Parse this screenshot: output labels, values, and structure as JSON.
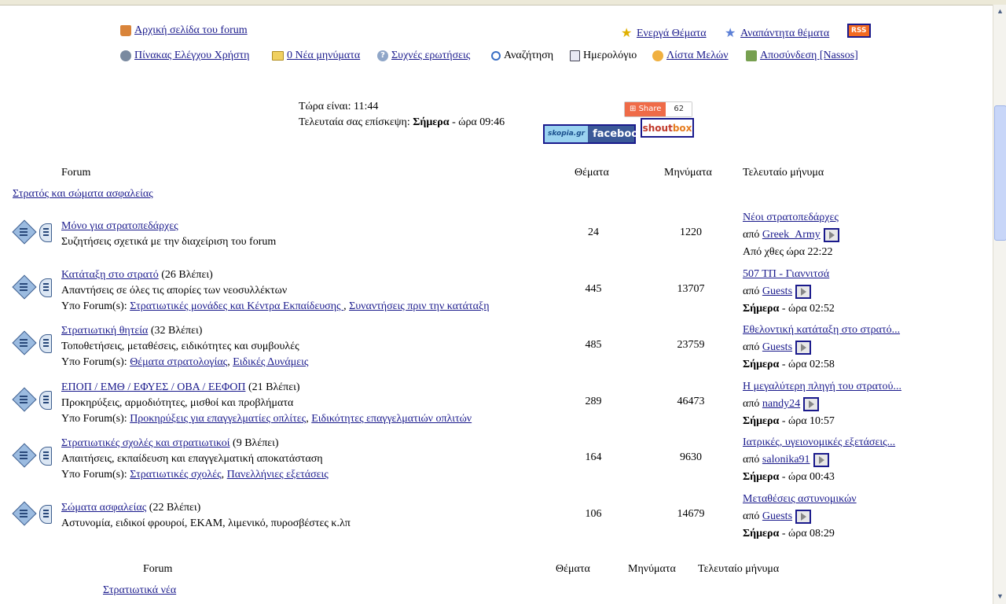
{
  "nav_row1": {
    "home": "Αρχική σελίδα του forum",
    "active_topics": "Ενεργά Θέματα",
    "unanswered": "Αναπάντητα θέματα",
    "rss": "RSS"
  },
  "nav_row2": {
    "control_panel": "Πίνακας Ελέγχου Χρήστη",
    "messages": "0 Νέα μηνύματα",
    "faq": "Συχνές ερωτήσεις",
    "search": "Αναζήτηση",
    "calendar": "Ημερολόγιο",
    "members": "Λίστα Μελών",
    "logout": "Αποσύνδεση [Nassos]"
  },
  "info": {
    "time_line": "Τώρα είναι: 11:44",
    "last_visit_prefix": "Τελευταία σας επίσκεψη: ",
    "last_visit_day": "Σήμερα",
    "last_visit_time": " - ώρα 09:46"
  },
  "share": {
    "label": "Share",
    "count": "62"
  },
  "badges": {
    "skopia": "skopia.gr",
    "facebook": "facebook",
    "shout1": "shout",
    "shout2": "box"
  },
  "table_header": {
    "forum": "Forum",
    "topics": "Θέματα",
    "posts": "Μηνύματα",
    "last_post": "Τελευταίο μήνυμα"
  },
  "category1": "Στρατός και σώματα ασφαλείας",
  "forums": [
    {
      "title": "Μόνο για στρατοπεδάρχες",
      "viewers": "",
      "desc": "Συζητήσεις σχετικά με την διαχείριση του forum",
      "sub_label": "",
      "subs": [],
      "topics": "24",
      "posts": "1220",
      "last_title": "Νέοι στρατοπεδάρχες",
      "by": "από ",
      "last_user": "Greek_Army",
      "last_day": "",
      "last_time": "Από χθες ώρα 22:22"
    },
    {
      "title": "Κατάταξη στο στρατό",
      "viewers": " (26 Βλέπει)",
      "desc": "Απαντήσεις σε όλες τις απορίες των νεοσυλλέκτων",
      "sub_label": "Υπο Forum(s): ",
      "subs": [
        "Στρατιωτικές μονάδες και Κέντρα Εκπαίδευσης ",
        "Συναντήσεις πριν την κατάταξη"
      ],
      "topics": "445",
      "posts": "13707",
      "last_title": "507 ΤΠ - Γιαννιτσά",
      "by": "από ",
      "last_user": "Guests",
      "last_day": "Σήμερα",
      "last_time": " - ώρα 02:52"
    },
    {
      "title": "Στρατιωτική θητεία",
      "viewers": " (32 Βλέπει)",
      "desc": "Τοποθετήσεις, μεταθέσεις, ειδικότητες και συμβουλές",
      "sub_label": "Υπο Forum(s): ",
      "subs": [
        "Θέματα στρατολογίας",
        "Ειδικές Δυνάμεις"
      ],
      "topics": "485",
      "posts": "23759",
      "last_title": "Εθελοντική κατάταξη στο στρατό...",
      "by": "από ",
      "last_user": "Guests",
      "last_day": "Σήμερα",
      "last_time": " - ώρα 02:58"
    },
    {
      "title": "ΕΠΟΠ / ΕΜΘ / ΕΦΥΕΣ / ΟΒΑ / ΕΕΦΟΠ",
      "viewers": " (21 Βλέπει)",
      "desc": "Προκηρύξεις, αρμοδιότητες, μισθοί και προβλήματα",
      "sub_label": "Υπο Forum(s): ",
      "subs": [
        "Προκηρύξεις για επαγγελματίες οπλίτες",
        "Ειδικότητες επαγγελματιών οπλιτών"
      ],
      "topics": "289",
      "posts": "46473",
      "last_title": "Η μεγαλύτερη πληγή του στρατού...",
      "by": "από ",
      "last_user": "nandy24",
      "last_day": "Σήμερα",
      "last_time": " - ώρα 10:57"
    },
    {
      "title": "Στρατιωτικές σχολές και στρατιωτικοί",
      "viewers": " (9 Βλέπει)",
      "desc": "Απαιτήσεις, εκπαίδευση και επαγγελματική αποκατάσταση",
      "sub_label": "Υπο Forum(s): ",
      "subs": [
        "Στρατιωτικές σχολές",
        "Πανελλήνιες εξετάσεις"
      ],
      "topics": "164",
      "posts": "9630",
      "last_title": "Ιατρικές, υγειονομικές εξετάσεις...",
      "by": "από ",
      "last_user": "salonika91",
      "last_day": "Σήμερα",
      "last_time": " - ώρα 00:43"
    },
    {
      "title": "Σώματα ασφαλείας",
      "viewers": " (22 Βλέπει)",
      "desc": "Αστυνομία, ειδικοί φρουροί, ΕΚΑΜ, λιμενικό, πυροσβέστες κ.λπ",
      "sub_label": "",
      "subs": [],
      "topics": "106",
      "posts": "14679",
      "last_title": "Μεταθέσεις αστυνομικών",
      "by": "από ",
      "last_user": "Guests",
      "last_day": "Σήμερα",
      "last_time": " - ώρα 08:29"
    }
  ],
  "table_header2": {
    "forum": "Forum",
    "topics": "Θέματα",
    "posts": "Μηνύματα",
    "last_post": "Τελευταίο μήνυμα"
  },
  "category2": "Στρατιωτικά νέα"
}
